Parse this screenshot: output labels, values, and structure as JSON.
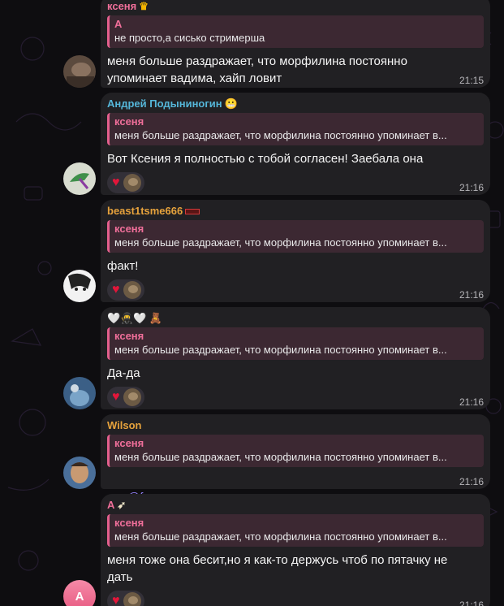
{
  "colors": {
    "background": "#0e0d10",
    "bubble": "#212023",
    "reply_bar": "#e35f8d",
    "heart": "#e3163a",
    "mention": "#8e7cf0"
  },
  "messages": [
    {
      "sender": "ксеня",
      "sender_color": "#f06f9a",
      "sender_badge": "crown-icon",
      "reply_name": "А",
      "reply_text": "не просто,а сисько стримерша",
      "text": "меня больше раздражает, что морфилина постоянно\nупоминает вадима, хайп ловит",
      "time": "21:15"
    },
    {
      "sender": "Андрей Подыниногин",
      "sender_color": "#55b6d9",
      "sender_badge": "grimace-emoji-icon",
      "reply_name": "ксеня",
      "reply_text": "меня больше раздражает, что морфилина постоянно упоминает в...",
      "text": "Вот Ксения я полностью с тобой согласен! Заебала она",
      "reaction": "heart-icon",
      "time": "21:16"
    },
    {
      "sender": "beast1tsme666",
      "sender_color": "#e6a23c",
      "sender_badge": "red-badge-icon",
      "reply_name": "ксеня",
      "reply_text": "меня больше раздражает, что морфилина постоянно упоминает в...",
      "text": "факт!",
      "reaction": "heart-icon",
      "time": "21:16"
    },
    {
      "sender": "🤍🥷🤍",
      "sender_color": "#ffffff",
      "sender_badge": "sticker-emoji-icon",
      "reply_name": "ксеня",
      "reply_text": "меня больше раздражает, что морфилина постоянно упоминает в...",
      "text": "Да-да",
      "reaction": "heart-icon",
      "time": "21:16"
    },
    {
      "sender": "Wilson",
      "sender_color": "#e6a23c",
      "reply_name": "ксеня",
      "reply_text": "меня больше раздражает, что морфилина постоянно упоминает в...",
      "mention": "@fan_gsx",
      "time": "21:16"
    },
    {
      "sender": "А",
      "sender_color": "#f06f9a",
      "sender_badge": "paper-plane-emoji-icon",
      "avatar_letter": "А",
      "reply_name": "ксеня",
      "reply_text": "меня больше раздражает, что морфилина постоянно упоминает в...",
      "text": "меня тоже она бесит,но я как-то держусь чтоб по пятачку не\nдать",
      "reaction": "heart-icon",
      "time": "21:16"
    }
  ]
}
